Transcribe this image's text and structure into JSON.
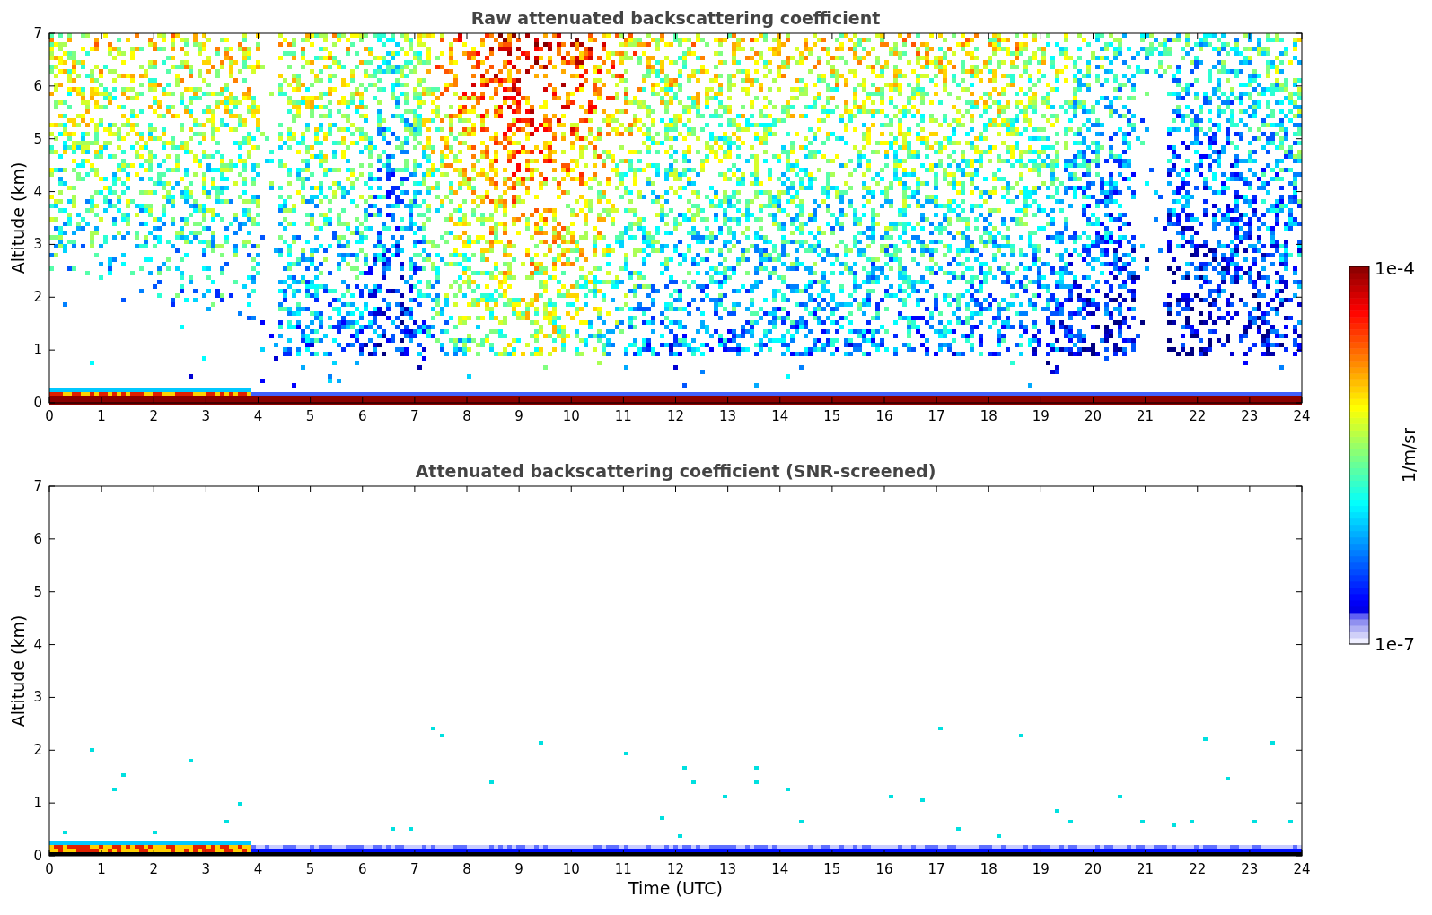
{
  "panels": [
    {
      "kind": "raw",
      "title": "Raw attenuated backscattering coefficient",
      "ylabel": "Altitude (km)",
      "yticks": [
        "7",
        "6",
        "5",
        "4",
        "3",
        "2",
        "1",
        "0"
      ],
      "xticks": [
        "0",
        "1",
        "2",
        "3",
        "4",
        "5",
        "6",
        "7",
        "8",
        "9",
        "10",
        "11",
        "12",
        "13",
        "14",
        "15",
        "16",
        "17",
        "18",
        "19",
        "20",
        "21",
        "22",
        "23",
        "24"
      ]
    },
    {
      "kind": "screened",
      "title": "Attenuated backscattering coefficient (SNR-screened)",
      "ylabel": "Altitude (km)",
      "xlabel": "Time (UTC)",
      "yticks": [
        "7",
        "6",
        "5",
        "4",
        "3",
        "2",
        "1",
        "0"
      ],
      "xticks": [
        "0",
        "1",
        "2",
        "3",
        "4",
        "5",
        "6",
        "7",
        "8",
        "9",
        "10",
        "11",
        "12",
        "13",
        "14",
        "15",
        "16",
        "17",
        "18",
        "19",
        "20",
        "21",
        "22",
        "23",
        "24"
      ]
    }
  ],
  "colorbar": {
    "max_label": "1e-4",
    "min_label": "1e-7",
    "label": "1/m/sr"
  }
}
